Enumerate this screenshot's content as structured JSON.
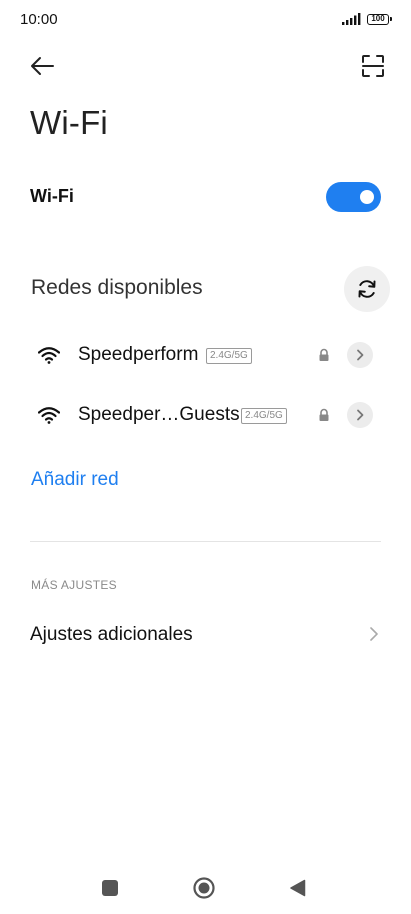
{
  "status_bar": {
    "time": "10:00",
    "battery_level": "100",
    "icons": [
      "signal-icon",
      "battery-icon"
    ]
  },
  "header": {
    "back_icon": "arrow-left-icon",
    "scan_icon": "qr-scan-icon",
    "title": "Wi-Fi"
  },
  "wifi_switch": {
    "label": "Wi-Fi",
    "enabled": true,
    "accent_color": "#1f7ff0"
  },
  "networks_section": {
    "title": "Redes disponibles",
    "refresh_icon": "refresh-icon",
    "networks": [
      {
        "name": "Speedperform",
        "band": "2.4G/5G",
        "secured": true,
        "icon": "wifi-signal-icon"
      },
      {
        "name": "Speedper…Guests",
        "band": "2.4G/5G",
        "secured": true,
        "icon": "wifi-signal-icon"
      }
    ],
    "add_network_label": "Añadir red"
  },
  "more_settings": {
    "header": "MÁS AJUSTES",
    "additional_label": "Ajustes adicionales"
  },
  "nav_bar": {
    "icons": [
      "recents-square-icon",
      "home-circle-icon",
      "back-triangle-icon"
    ]
  }
}
